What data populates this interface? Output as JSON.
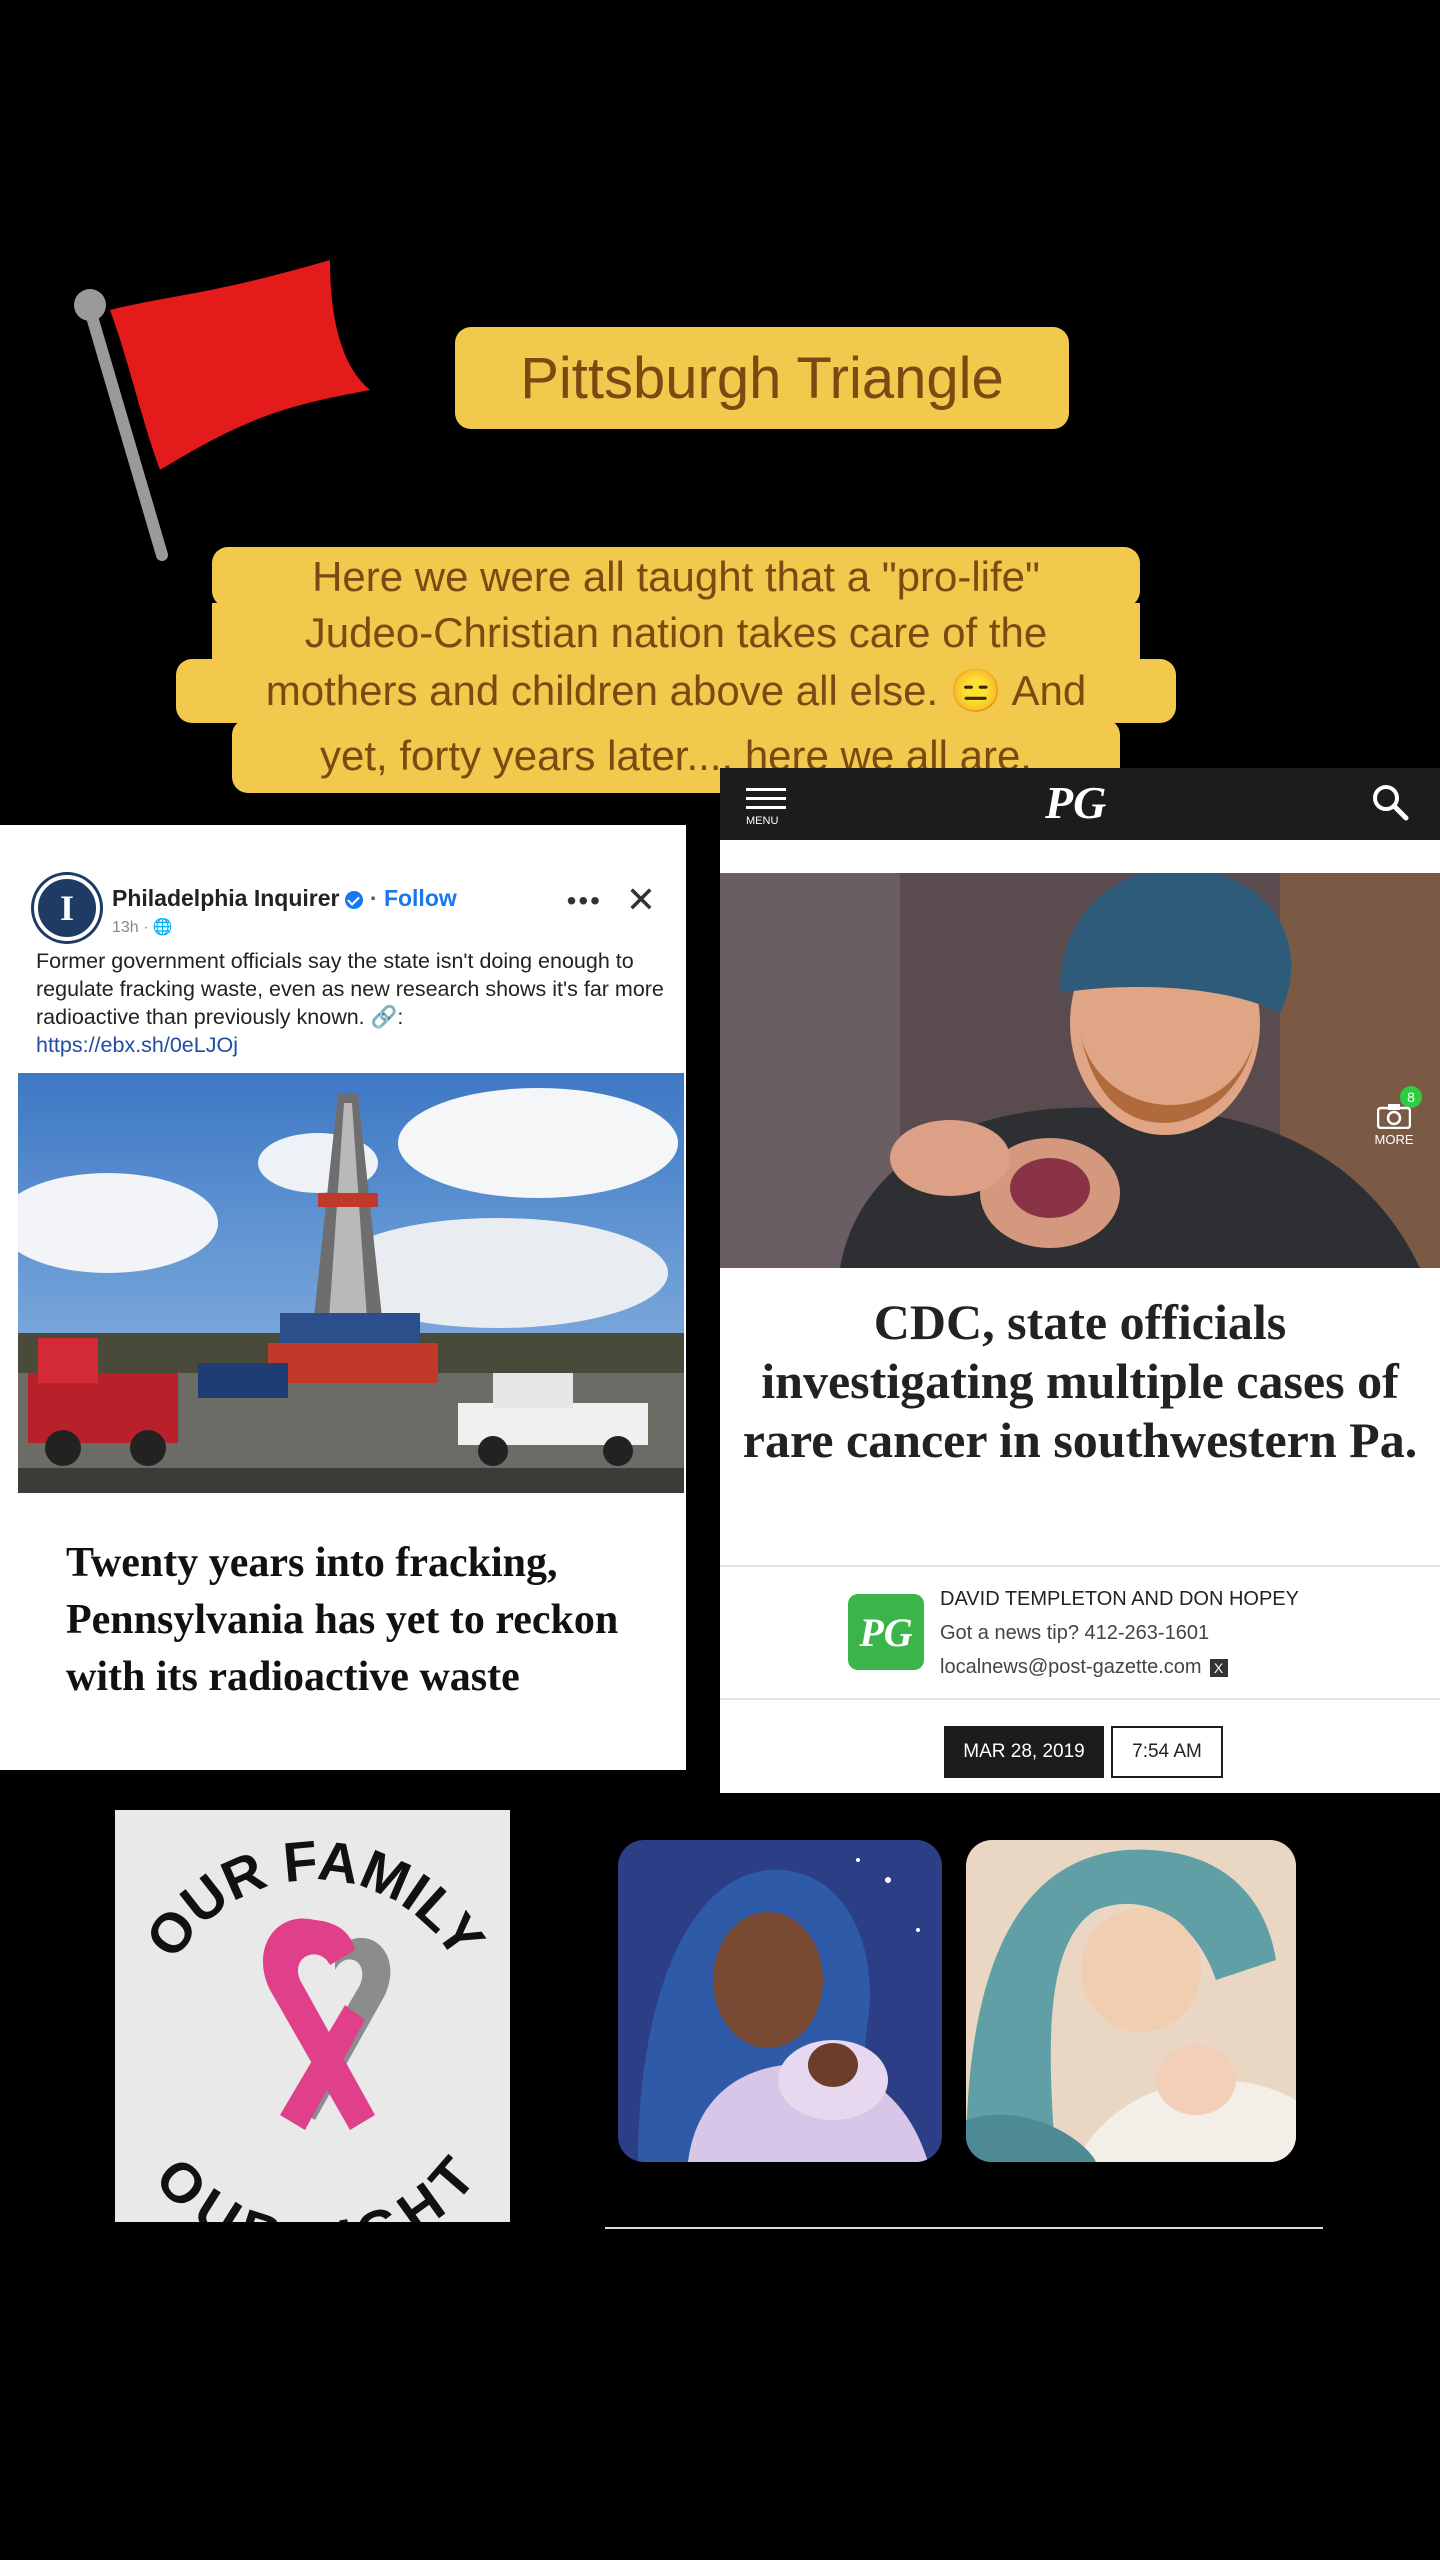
{
  "title": "Pittsburgh Triangle",
  "caption_lines": [
    "Here we were all taught that a  \"pro-life\"",
    "Judeo-Christian nation takes care of the",
    "mothers  and children above all else. 😑 And",
    "yet, forty years later.... here we all are."
  ],
  "inquirer_post": {
    "page_name": "Philadelphia Inquirer",
    "follow_label": "Follow",
    "meta": "13h · 🌐",
    "body_text": "Former government officials say the state isn't doing enough to regulate fracking waste, even as new research shows it's far more radioactive than previously known. 🔗:",
    "link": "https://ebx.sh/0eLJOj",
    "more_icon": "ellipsis-icon",
    "close_icon": "close-icon",
    "headline": "Twenty years into fracking, Pennsylvania has yet to reckon with its radioactive waste"
  },
  "post_gazette": {
    "menu_label": "MENU",
    "logo": "PG",
    "photo_more_label": "MORE",
    "photo_count": "8",
    "headline": "CDC, state officials investigating multiple cases of rare cancer in southwestern Pa.",
    "badge": "PG",
    "author": "DAVID TEMPLETON AND DON HOPEY",
    "tip": "Got a news tip? 412-263-1601",
    "email": "localnews@post-gazette.com",
    "date": "MAR 28, 2019",
    "time": "7:54 AM"
  },
  "ribbon_image": {
    "top_text": "OUR FAMILY",
    "bottom_text": "OUR FIGHT",
    "ribbon_color": "#e0408a"
  },
  "colors": {
    "caption_bg": "#f2c94c",
    "caption_text": "#7a4a12",
    "flag": "#e31b1b"
  }
}
